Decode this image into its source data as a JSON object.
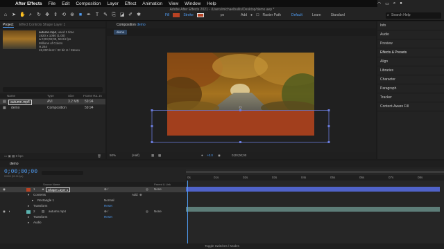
{
  "menubar": {
    "app": "After Effects",
    "items": [
      "File",
      "Edit",
      "Composition",
      "Layer",
      "Effect",
      "Animation",
      "View",
      "Window",
      "Help"
    ]
  },
  "toolbar": {
    "title": "Adobe After Effects 2021 - /Users/michaelbullis/Desktop/demo.aep *",
    "fill_label": "Fill",
    "stroke_label": "Stroke",
    "stroke_px": "px",
    "add_label": "Add",
    "raster_path": "Raster Path",
    "workspaces": [
      "Default",
      "Learn",
      "Standard"
    ],
    "search_placeholder": "Search Help",
    "fill_color": "#b84223"
  },
  "project": {
    "tabs": [
      "Project",
      "Effect Controls Shape Layer 1"
    ],
    "thumb_name": "autumn.mp4",
    "thumb_used": ", used 1 time",
    "thumb_info": [
      "1920 x 1080 (1.00)",
      "Δ 0;00;08;00, 59.94 fps",
      "Millions of Colors",
      "H.264",
      "48,000 kHz / 32 bit U / Stereo"
    ],
    "columns": [
      "Name",
      "Type",
      "Size",
      "Frame Ra...",
      "In Po"
    ],
    "rows": [
      {
        "name": "autumn.mp4",
        "type": "AVI",
        "size": "3.2 MB",
        "rate": "59.94"
      },
      {
        "name": "demo",
        "type": "Composition",
        "size": "",
        "rate": "59.94"
      }
    ],
    "footer": "8 bpc"
  },
  "composition": {
    "tab_prefix": "Composition",
    "tab_name": "demo",
    "breadcrumb": "demo",
    "zoom": "50%",
    "resolution": "(Half)",
    "exposure": "+0.0",
    "timecode": "0;00;00;00"
  },
  "right_panel": {
    "items": [
      "Info",
      "Audio",
      "Preview",
      "Effects & Presets",
      "Align",
      "Libraries",
      "Character",
      "Paragraph",
      "Tracker",
      "Content-Aware Fill"
    ]
  },
  "timeline": {
    "tab": "demo",
    "timecode": "0;00;00;00",
    "fps_text": "00000 (59.94 fps)",
    "columns": [
      "Source Name",
      "Parent & Link"
    ],
    "layers": [
      {
        "num": "1",
        "name": "Shape Layer 1",
        "parent": "None"
      },
      {
        "num": "2",
        "name": "autumn.mp4",
        "parent": "None"
      }
    ],
    "contents_label": "Contents",
    "add_label": "Add:",
    "rectangle_label": "Rectangle 1",
    "blend_mode": "Normal",
    "transform_label": "Transform",
    "reset_label": "Reset",
    "audio_label": "Audio",
    "ruler": [
      "0s",
      "01s",
      "02s",
      "03s",
      "04s",
      "05s",
      "06s",
      "07s",
      "08s"
    ],
    "footer": "Toggle Switches / Modes"
  },
  "colors": {
    "accent": "#4f9df5",
    "shape_fill": "#b84223",
    "shape_bar": "#5063c9",
    "video_bar": "#5d7d78"
  }
}
